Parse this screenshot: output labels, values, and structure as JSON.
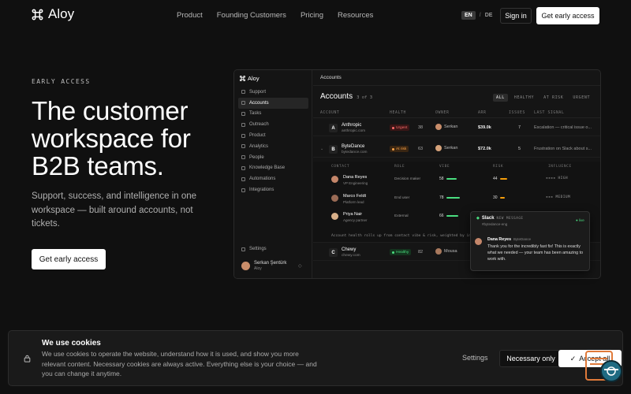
{
  "nav": {
    "brand": "Aloy",
    "links": [
      "Product",
      "Founding Customers",
      "Pricing",
      "Resources"
    ],
    "lang_active": "EN",
    "lang_sep": "/",
    "lang_other": "DE",
    "signin": "Sign in",
    "cta": "Get early access"
  },
  "hero": {
    "eyebrow": "EARLY ACCESS",
    "headline": "The customer workspace for B2B teams.",
    "sub": "Support, success, and intelligence in one workspace — built around accounts, not tickets.",
    "cta": "Get early access"
  },
  "app": {
    "brand": "Aloy",
    "sidebar": [
      "Support",
      "Accounts",
      "Tasks",
      "Outreach",
      "Product",
      "Analytics",
      "People",
      "Knowledge Base",
      "Automations",
      "Integrations"
    ],
    "active_item": "Accounts",
    "settings": "Settings",
    "user": {
      "name": "Serkan Şentürk",
      "workspace": "Aloy"
    },
    "crumb": "Accounts",
    "title": "Accounts",
    "count": "3 of 3",
    "filters": [
      "ALL",
      "HEALTHY",
      "AT RISK",
      "URGENT"
    ],
    "active_filter": "ALL",
    "columns": [
      "ACCOUNT",
      "HEALTH",
      "OWNER",
      "ARR",
      "ISSUES",
      "LAST SIGNAL"
    ],
    "accounts": [
      {
        "initial": "A",
        "name": "Anthropic",
        "domain": "anthropic.com",
        "health": "Urgent",
        "score": "38",
        "owner": "Serkan",
        "arr": "$39.0k",
        "issues": "7",
        "signal": "Escalation — critical issue o..."
      },
      {
        "initial": "B",
        "name": "ByteDance",
        "domain": "bytedance.com",
        "health": "At risk",
        "score": "63",
        "owner": "Serkan",
        "arr": "$72.0k",
        "issues": "5",
        "signal": "Frustration on Slack about s..."
      },
      {
        "initial": "C",
        "name": "Chewy",
        "domain": "chewy.com",
        "health": "Healthy",
        "score": "82",
        "owner": "Mousa",
        "arr": "",
        "issues": "",
        "signal": ""
      }
    ],
    "contact_columns": [
      "CONTACT",
      "ROLE",
      "VIBE",
      "RISK",
      "INFLUENCE"
    ],
    "contacts": [
      {
        "name": "Dana Reyes",
        "title": "VP Engineering",
        "role": "Decision maker",
        "vibe": "58",
        "risk": "44",
        "influence": "HIGH"
      },
      {
        "name": "Marco Feldt",
        "title": "Platform lead",
        "role": "End user",
        "vibe": "78",
        "risk": "30",
        "influence": "MEDIUM"
      },
      {
        "name": "Priya Nair",
        "title": "Agency partner",
        "role": "External",
        "vibe": "66",
        "risk": "",
        "influence": ""
      }
    ],
    "contact_note": "Account health rolls up from contact vibe & risk, weighted by in..."
  },
  "slack": {
    "source": "Slack",
    "tag": "NEW MESSAGE",
    "channel": "#bytedance-eng",
    "status": "● live",
    "sender": "Dana Reyes",
    "org": "ByteDance",
    "message": "Thank you for the incredibly fast fix! This is exactly what we needed — your team has been amazing to work with."
  },
  "cookie": {
    "title": "We use cookies",
    "body": "We use cookies to operate the website, understand how it is used, and show you more relevant content. Necessary cookies are always active. Everything else is your choice — and you can change it anytime.",
    "settings": "Settings",
    "necessary": "Necessary only",
    "accept": "Accept all"
  },
  "colors": {
    "background": "#101010",
    "urgent": "#ff6b6b",
    "at_risk": "#ffa54a",
    "healthy": "#4ade80",
    "risk_bar": "#f59e0b",
    "widget": "#e07a3a"
  }
}
